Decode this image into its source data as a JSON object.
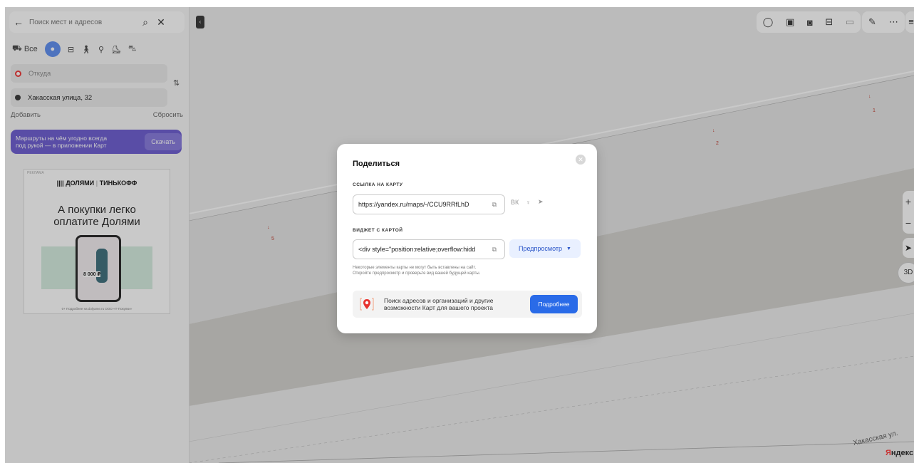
{
  "search": {
    "placeholder": "Поиск мест и адресов"
  },
  "modes": {
    "all_label": "Все"
  },
  "route": {
    "from_placeholder": "Откуда",
    "to_value": "Хакасская улица, 32",
    "add_label": "Добавить",
    "reset_label": "Сбросить"
  },
  "promo": {
    "line1": "Маршруты на чём угодно всегда",
    "line2": "под рукой — в приложении Карт",
    "button": "Скачать"
  },
  "ad": {
    "label": "РЕКЛАМА",
    "brand1": "|||| ДОЛЯМИ",
    "brand2": "ТИНЬКОФФ",
    "headline_line1": "А покупки легко",
    "headline_line2": "оплатите Долями",
    "price": "8 000 ₽",
    "fineprint": "0+ Подробнее на dolyame.ru ООО «Т-Покупки»"
  },
  "map": {
    "street": "Хакасская ул.",
    "logo_first": "Я",
    "logo_rest": "ндекс",
    "poi": [
      "1",
      "2",
      "5"
    ],
    "threed_label": "3D"
  },
  "dialog": {
    "title": "Поделиться",
    "link_label": "ССЫЛКА НА КАРТУ",
    "link_value": "https://yandex.ru/maps/-/CCU9RRfLhD",
    "share_vk": "ВК",
    "widget_label": "ВИДЖЕТ С КАРТОЙ",
    "widget_value": "<div style=\"position:relative;overflow:hidd",
    "preview_label": "Предпросмотр",
    "note_line1": "Некоторые элементы карты не могут быть вставлены на сайт.",
    "note_line2": "Откройте предпросмотр и проверьте вид вашей будущей карты.",
    "info_line1": "Поиск адресов и организаций и другие",
    "info_line2": "возможности Карт для вашего проекта",
    "info_button": "Подробнее"
  }
}
